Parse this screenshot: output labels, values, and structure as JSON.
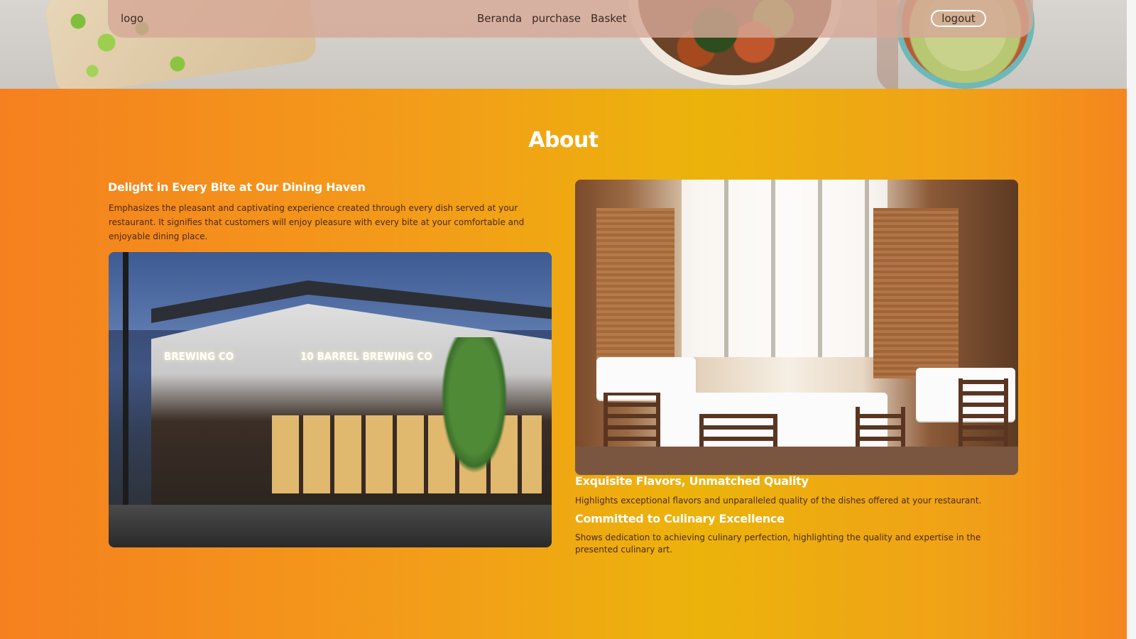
{
  "nav": {
    "logo": "logo",
    "items": [
      "Beranda",
      "purchase",
      "Basket"
    ],
    "logout_label": "logout"
  },
  "about": {
    "title": "About",
    "left": {
      "headline": "Delight in Every Bite at Our Dining Haven",
      "text": "Emphasizes the pleasant and captivating experience created through every dish served at your restaurant. It signifies that customers will enjoy pleasure with every bite at your comfortable and enjoyable dining place.",
      "sign_text_1": "BREWING CO",
      "sign_text_2": "10 BARREL BREWING CO"
    },
    "right": {
      "headline_1": "Exquisite Flavors, Unmatched Quality",
      "text_1": "Highlights exceptional flavors and unparalleled quality of the dishes offered at your restaurant.",
      "headline_2": "Committed to Culinary Excellence",
      "text_2": "Shows dedication to achieving culinary perfection, highlighting the quality and expertise in the presented culinary art."
    }
  },
  "colors": {
    "gradient_left": "#f5801f",
    "gradient_mid": "#ecb30b",
    "nav_bg": "#d6a896",
    "headline": "#ffffff",
    "body_text": "#4a2a18"
  },
  "icons": [
    "hero-food-image",
    "brewery-image",
    "dining-room-image"
  ]
}
